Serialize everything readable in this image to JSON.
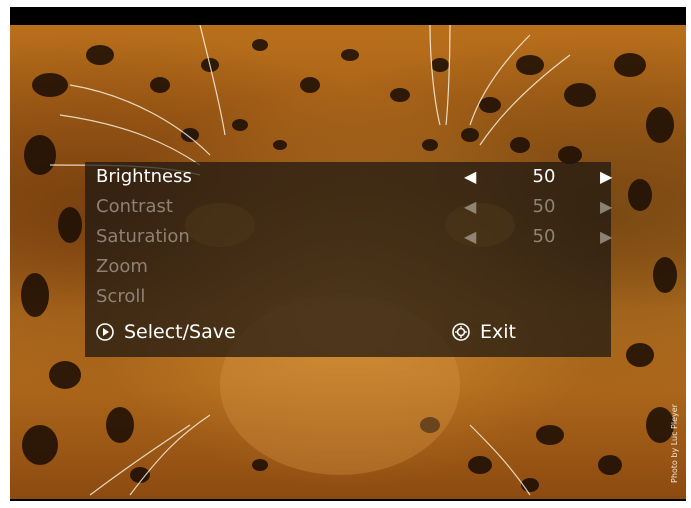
{
  "menu": {
    "items": [
      {
        "label": "Brightness",
        "value": "50",
        "state": "active"
      },
      {
        "label": "Contrast",
        "value": "50",
        "state": "dim"
      },
      {
        "label": "Saturation",
        "value": "50",
        "state": "dim"
      },
      {
        "label": "Zoom",
        "state": "dim"
      },
      {
        "label": "Scroll",
        "state": "dim"
      }
    ],
    "select_label": "Select/Save",
    "exit_label": "Exit"
  },
  "background": {
    "credit": "Photo by Luc Pleyer"
  },
  "colors": {
    "panel": "#1c1612",
    "active_text": "#ffffff",
    "dim_text": "#aaa096"
  },
  "icons": {
    "left_arrow": "triangle-left",
    "right_arrow": "triangle-right",
    "select": "play-circle",
    "exit": "gear-circle"
  }
}
